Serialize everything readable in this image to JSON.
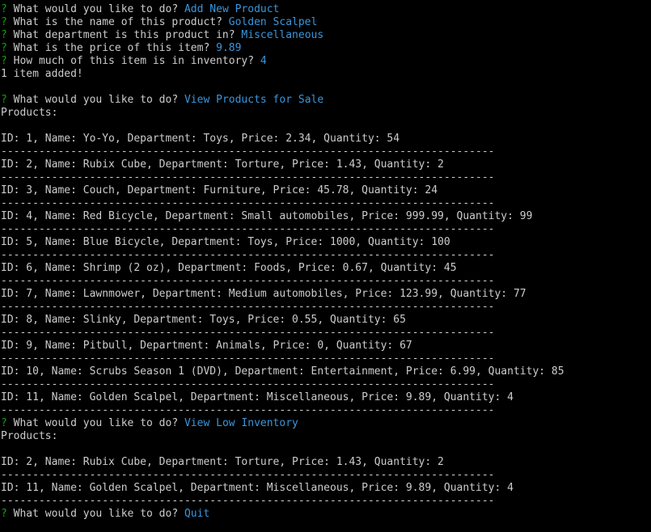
{
  "colors": {
    "background": "#000000",
    "text": "#cccccc",
    "prompt_mark": "#13a10e",
    "answer": "#3a96dd"
  },
  "prompt_mark": "?",
  "lines": [
    {
      "type": "prompt",
      "question": "What would you like to do?",
      "answer": "Add New Product"
    },
    {
      "type": "prompt",
      "question": "What is the name of this product?",
      "answer": "Golden Scalpel"
    },
    {
      "type": "prompt",
      "question": "What department is this product in?",
      "answer": "Miscellaneous"
    },
    {
      "type": "prompt",
      "question": "What is the price of this item?",
      "answer": "9.89"
    },
    {
      "type": "prompt",
      "question": "How much of this item is in inventory?",
      "answer": "4"
    },
    {
      "type": "text",
      "text": "1 item added!"
    },
    {
      "type": "blank"
    },
    {
      "type": "prompt",
      "question": "What would you like to do?",
      "answer": "View Products for Sale"
    },
    {
      "type": "text",
      "text": "Products:"
    },
    {
      "type": "blank"
    },
    {
      "type": "text",
      "text": "ID: 1, Name: Yo-Yo, Department: Toys, Price: 2.34, Quantity: 54"
    },
    {
      "type": "sep",
      "text": "------------------------------------------------------------------------------"
    },
    {
      "type": "text",
      "text": "ID: 2, Name: Rubix Cube, Department: Torture, Price: 1.43, Quantity: 2"
    },
    {
      "type": "sep",
      "text": "------------------------------------------------------------------------------"
    },
    {
      "type": "text",
      "text": "ID: 3, Name: Couch, Department: Furniture, Price: 45.78, Quantity: 24"
    },
    {
      "type": "sep",
      "text": "------------------------------------------------------------------------------"
    },
    {
      "type": "text",
      "text": "ID: 4, Name: Red Bicycle, Department: Small automobiles, Price: 999.99, Quantity: 99"
    },
    {
      "type": "sep",
      "text": "------------------------------------------------------------------------------"
    },
    {
      "type": "text",
      "text": "ID: 5, Name: Blue Bicycle, Department: Toys, Price: 1000, Quantity: 100"
    },
    {
      "type": "sep",
      "text": "------------------------------------------------------------------------------"
    },
    {
      "type": "text",
      "text": "ID: 6, Name: Shrimp (2 oz), Department: Foods, Price: 0.67, Quantity: 45"
    },
    {
      "type": "sep",
      "text": "------------------------------------------------------------------------------"
    },
    {
      "type": "text",
      "text": "ID: 7, Name: Lawnmower, Department: Medium automobiles, Price: 123.99, Quantity: 77"
    },
    {
      "type": "sep",
      "text": "------------------------------------------------------------------------------"
    },
    {
      "type": "text",
      "text": "ID: 8, Name: Slinky, Department: Toys, Price: 0.55, Quantity: 65"
    },
    {
      "type": "sep",
      "text": "------------------------------------------------------------------------------"
    },
    {
      "type": "text",
      "text": "ID: 9, Name: Pitbull, Department: Animals, Price: 0, Quantity: 67"
    },
    {
      "type": "sep",
      "text": "------------------------------------------------------------------------------"
    },
    {
      "type": "text",
      "text": "ID: 10, Name: Scrubs Season 1 (DVD), Department: Entertainment, Price: 6.99, Quantity: 85"
    },
    {
      "type": "sep",
      "text": "------------------------------------------------------------------------------"
    },
    {
      "type": "text",
      "text": "ID: 11, Name: Golden Scalpel, Department: Miscellaneous, Price: 9.89, Quantity: 4"
    },
    {
      "type": "sep",
      "text": "------------------------------------------------------------------------------"
    },
    {
      "type": "prompt",
      "question": "What would you like to do?",
      "answer": "View Low Inventory"
    },
    {
      "type": "text",
      "text": "Products:"
    },
    {
      "type": "blank"
    },
    {
      "type": "text",
      "text": "ID: 2, Name: Rubix Cube, Department: Torture, Price: 1.43, Quantity: 2"
    },
    {
      "type": "sep",
      "text": "------------------------------------------------------------------------------"
    },
    {
      "type": "text",
      "text": "ID: 11, Name: Golden Scalpel, Department: Miscellaneous, Price: 9.89, Quantity: 4"
    },
    {
      "type": "sep",
      "text": "------------------------------------------------------------------------------"
    },
    {
      "type": "prompt",
      "question": "What would you like to do?",
      "answer": "Quit"
    }
  ]
}
